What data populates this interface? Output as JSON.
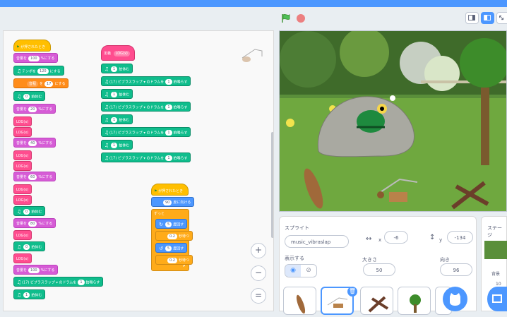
{
  "stage_header": {
    "flag_icon": "green-flag-icon",
    "stop_icon": "stop-icon"
  },
  "workspace": {
    "script1": {
      "hat": "が押されたとき",
      "b1": "音量を",
      "b1v": "100",
      "b1e": "%にする",
      "b2": "テンポを",
      "b2v": "120",
      "b2e": "にする",
      "b3": "音程",
      "b3b": "を",
      "b3v": "17",
      "b3e": "にする",
      "rest1v": "0",
      "rest1e": "拍休む",
      "vol20": "音量を",
      "vol20v": "20",
      "vol20e": "%にする",
      "plain1": "LOG(x)",
      "plain2": "LOG(x)",
      "vol40": "音量を",
      "vol40v": "40",
      "vol40e": "%にする",
      "plain3": "LOG(x)",
      "plain4": "LOG(x)",
      "vol60": "音量を",
      "vol60v": "60",
      "vol60e": "%にする",
      "plain5": "LOG(x)",
      "plain6": "LOG(x)",
      "rest2v": "0",
      "rest2e": "拍休む",
      "vol80": "音量を",
      "vol80v": "80",
      "vol80e": "%にする",
      "plain7": "LOG(x)",
      "rest3v": "0",
      "rest3e": "拍休む",
      "plain8": "LOG(x)",
      "vol100": "音量を",
      "vol100v": "100",
      "vol100e": "%にする",
      "drum": "(17) ビブラスラップ ▾",
      "drum_mid": "のドラムを",
      "drumv": "1",
      "drume": "拍鳴らす",
      "rest4v": "1",
      "rest4e": "拍休む"
    },
    "script2": {
      "hat": "定義",
      "hatv": "LOG(x)",
      "rest": "拍休む",
      "restv": "1",
      "drum": "(17) ビブラスラップ ▾",
      "drum_mid": "のドラムを",
      "drumv": "1",
      "drume": "拍鳴らす"
    },
    "script3": {
      "hat": "が押されたとき",
      "b1v": "90",
      "b1e": "度に向ける",
      "forever": "ずっと",
      "turn1v": "5",
      "turn1e": "度回す",
      "wait1v": "0.2",
      "wait1e": "秒待つ",
      "turn2v": "5",
      "turn2e": "度回す",
      "wait2v": "0.2",
      "wait2e": "秒待つ"
    },
    "zoom": {
      "in": "+",
      "out": "−",
      "reset": "="
    }
  },
  "sprite_panel": {
    "sprite_label": "スプライト",
    "sprite_name": "music_vibraslap",
    "x_label": "x",
    "x_value": "-6",
    "y_label": "y",
    "y_value": "-134",
    "show_label": "表示する",
    "size_label": "大きさ",
    "size_value": "50",
    "dir_label": "向き",
    "dir_value": "96"
  },
  "stage_panel": {
    "label": "ステージ",
    "backdrop_label": "背景",
    "count": "10"
  }
}
